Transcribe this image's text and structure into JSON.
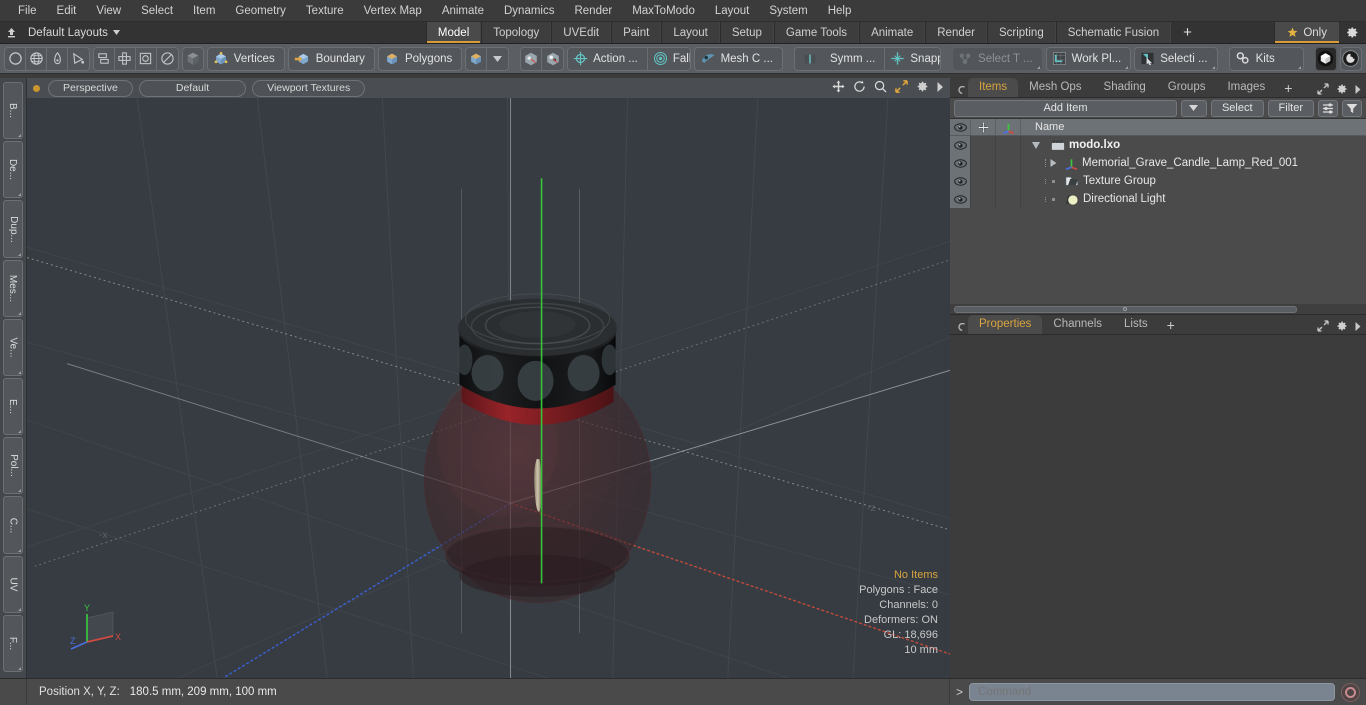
{
  "menubar": {
    "items": [
      "File",
      "Edit",
      "View",
      "Select",
      "Item",
      "Geometry",
      "Texture",
      "Vertex Map",
      "Animate",
      "Dynamics",
      "Render",
      "MaxToModo",
      "Layout",
      "System",
      "Help"
    ]
  },
  "layoutbar": {
    "home_icon": "home-arrow-icon",
    "layout_label": "Default Layouts",
    "tabs": [
      {
        "label": "Model",
        "active": true
      },
      {
        "label": "Topology",
        "active": false
      },
      {
        "label": "UVEdit",
        "active": false
      },
      {
        "label": "Paint",
        "active": false
      },
      {
        "label": "Layout",
        "active": false
      },
      {
        "label": "Setup",
        "active": false
      },
      {
        "label": "Game Tools",
        "active": false
      },
      {
        "label": "Animate",
        "active": false
      },
      {
        "label": "Render",
        "active": false
      },
      {
        "label": "Scripting",
        "active": false
      },
      {
        "label": "Schematic Fusion",
        "active": false
      }
    ],
    "add_tab_label": "+",
    "only_label": "Only",
    "only_icon": "star-icon",
    "gear_icon": "gear-icon",
    "accent_color": "#d89b3a"
  },
  "toolbar": {
    "group_primitives": [
      "circle-icon",
      "globe-icon",
      "pen-icon",
      "curve-icon"
    ],
    "group_mesh": [
      "mirror-icon",
      "array-icon",
      "frame-icon",
      "fade-icon"
    ],
    "single_cube": "cube-gray-icon",
    "selection_modes": [
      {
        "label": "Vertices",
        "icon": "cube-vertices-icon"
      },
      {
        "label": "Boundary",
        "icon": "cube-boundary-icon"
      },
      {
        "label": "Polygons",
        "icon": "cube-polygons-icon"
      }
    ],
    "mode_dropdown": {
      "icon": "cube-polygons-icon",
      "caret": "chevron-down-icon"
    },
    "pivot_icons": [
      "pivot-center-icon",
      "pivot-auto-icon"
    ],
    "actions": [
      {
        "label": "Action   ...",
        "icon": "action-center-icon"
      },
      {
        "label": "Falloff",
        "icon": "falloff-icon"
      },
      {
        "label": "Mesh C ...",
        "icon": "mesh-constraint-icon"
      },
      {
        "label": "Symm ...",
        "icon": "symmetry-icon"
      },
      {
        "label": "Snapping",
        "icon": "snapping-icon"
      },
      {
        "label": "Select T ...",
        "icon": "select-through-icon",
        "dim": true
      },
      {
        "label": "Work Pl...",
        "icon": "work-plane-icon"
      },
      {
        "label": "Selecti  ...",
        "icon": "selection-icon"
      },
      {
        "label": "Kits",
        "icon": "kits-gears-icon"
      }
    ],
    "right_icons": [
      "modo-ball-icon",
      "unreal-engine-icon"
    ]
  },
  "vertical_tabs": [
    "B...",
    "De...",
    "Dup...",
    "Mes...",
    "Ve...",
    "E...",
    "Pol...",
    "C...",
    "UV",
    "F..."
  ],
  "viewport": {
    "header": {
      "dot": "active-dot-icon",
      "pills": [
        "Perspective",
        "Default",
        "Viewport Textures"
      ],
      "right_icons": [
        "move-icon",
        "rotate-icon",
        "zoom-icon",
        "fit-icon",
        "gear-icon",
        "chevron-right-icon"
      ]
    },
    "stats": {
      "items_label": "No Items",
      "polygons": "Polygons : Face",
      "channels": "Channels: 0",
      "deformers": "Deformers: ON",
      "gl": "GL: 18,696",
      "scale": "10 mm"
    },
    "axis_gizmo": {
      "x": "X",
      "y": "Y",
      "z": "Z"
    },
    "negative_labels": {
      "neg_x": "-x",
      "neg_z": "-z"
    },
    "background_color": "#363c41",
    "scene_description": "Memorial grave candle lamp - dark red glass jar with black perforated metal lid and wick"
  },
  "right_panel": {
    "top_tabs": [
      {
        "label": "Items",
        "active": true
      },
      {
        "label": "Mesh Ops",
        "active": false
      },
      {
        "label": "Shading",
        "active": false
      },
      {
        "label": "Groups",
        "active": false
      },
      {
        "label": "Images",
        "active": false
      }
    ],
    "top_tabs_plus": "+",
    "top_tab_icons": [
      "expand-icon",
      "gear-icon",
      "chevron-right-icon"
    ],
    "add_item_label": "Add Item",
    "add_item_caret": "chevron-down-icon",
    "select_label": "Select",
    "filter_label": "Filter",
    "filter_list_icon": "list-filter-icon",
    "filter_funnel_icon": "funnel-icon",
    "list_columns": {
      "eye": "eye-icon",
      "lock": "plus-move-icon",
      "axis": "axis-icon",
      "name": "Name"
    },
    "items": [
      {
        "label": "modo.lxo",
        "icon": "scene-clapper-icon",
        "depth": 0,
        "expander": "triangle-down-icon",
        "root": true
      },
      {
        "label": "Memorial_Grave_Candle_Lamp_Red_001",
        "icon": "axis-mesh-icon",
        "depth": 1,
        "expander": "triangle-right-icon",
        "root": false
      },
      {
        "label": "Texture Group",
        "icon": "folder-texture-icon",
        "depth": 1,
        "expander": "dot-icon",
        "root": false
      },
      {
        "label": "Directional Light",
        "icon": "light-icon",
        "depth": 1,
        "expander": "dot-icon",
        "root": false
      }
    ],
    "bottom_tabs": [
      {
        "label": "Properties",
        "active": true
      },
      {
        "label": "Channels",
        "active": false
      },
      {
        "label": "Lists",
        "active": false
      }
    ],
    "bottom_tabs_plus": "+",
    "bottom_tab_icons": [
      "expand-icon",
      "gear-icon",
      "chevron-right-icon"
    ]
  },
  "statusbar": {
    "position_label": "Position X, Y, Z:",
    "position_value": "180.5 mm, 209 mm, 100 mm",
    "command_prompt": ">",
    "command_placeholder": "Command",
    "command_button_icon": "record-circle-icon"
  }
}
